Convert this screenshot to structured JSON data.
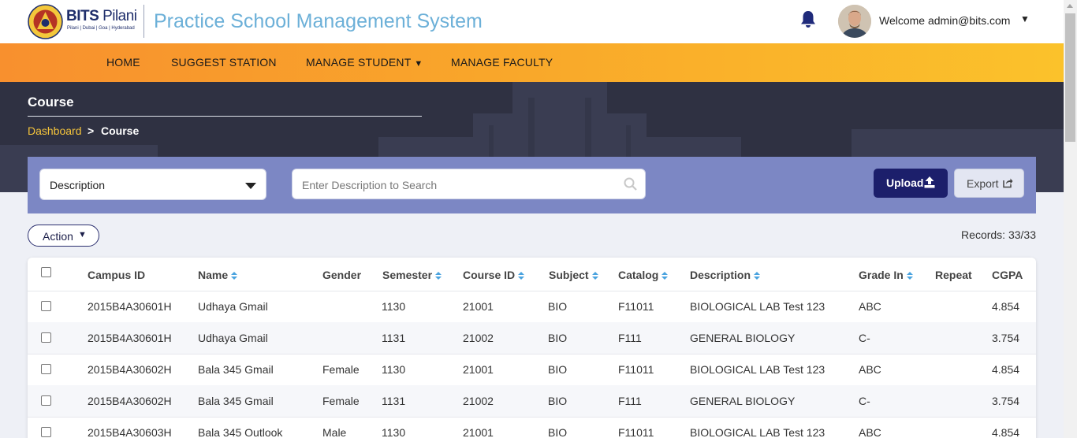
{
  "header": {
    "logo_name": "BITS",
    "logo_name_thin": "Pilani",
    "logo_sub": "Pilani | Dubai | Goa | Hyderabad",
    "app_title": "Practice School Management System",
    "welcome": "Welcome admin@bits.com",
    "caret": "▼",
    "icons": [
      "bell-icon",
      "avatar",
      "chevron-down-icon"
    ]
  },
  "nav": {
    "home": "HOME",
    "suggest": "SUGGEST STATION",
    "manage_student": "MANAGE STUDENT",
    "manage_student_caret": "▼",
    "manage_faculty": "MANAGE FACULTY"
  },
  "page": {
    "title": "Course",
    "breadcrumb_link": "Dashboard",
    "breadcrumb_sep": ">",
    "breadcrumb_current": "Course"
  },
  "filter": {
    "selected": "Description",
    "search_placeholder": "Enter Description to Search",
    "upload_label": "Upload",
    "export_label": "Export",
    "accent": "#7c87c4"
  },
  "toolbar": {
    "action_label": "Action",
    "action_caret": "▼",
    "records": "Records: 33/33"
  },
  "table": {
    "columns": [
      "Campus ID",
      "Name",
      "Gender",
      "Semester",
      "Course ID",
      "Subject",
      "Catalog",
      "Description",
      "Grade In",
      "Repeat",
      "CGPA"
    ],
    "rows": [
      [
        "2015B4A30601H",
        "Udhaya Gmail",
        "",
        "1130",
        "21001",
        "BIO",
        "F11011",
        "BIOLOGICAL LAB Test 123",
        "ABC",
        "",
        "4.854"
      ],
      [
        "2015B4A30601H",
        "Udhaya Gmail",
        "",
        "1131",
        "21002",
        "BIO",
        "F111",
        "GENERAL BIOLOGY",
        "C-",
        "",
        "3.754"
      ],
      [
        "2015B4A30602H",
        "Bala 345 Gmail",
        "Female",
        "1130",
        "21001",
        "BIO",
        "F11011",
        "BIOLOGICAL LAB Test 123",
        "ABC",
        "",
        "4.854"
      ],
      [
        "2015B4A30602H",
        "Bala 345 Gmail",
        "Female",
        "1131",
        "21002",
        "BIO",
        "F111",
        "GENERAL BIOLOGY",
        "C-",
        "",
        "3.754"
      ],
      [
        "2015B4A30603H",
        "Bala 345 Outlook",
        "Male",
        "1130",
        "21001",
        "BIO",
        "F11011",
        "BIOLOGICAL LAB Test 123",
        "ABC",
        "",
        "4.854"
      ]
    ]
  },
  "colors": {
    "nav_start": "#f8902e",
    "nav_end": "#fbc22b",
    "banner": "#2f3142",
    "primary_button": "#1c1f6b",
    "breadcrumb_link": "#f5c43b",
    "title_blue": "#6cb0d8"
  }
}
